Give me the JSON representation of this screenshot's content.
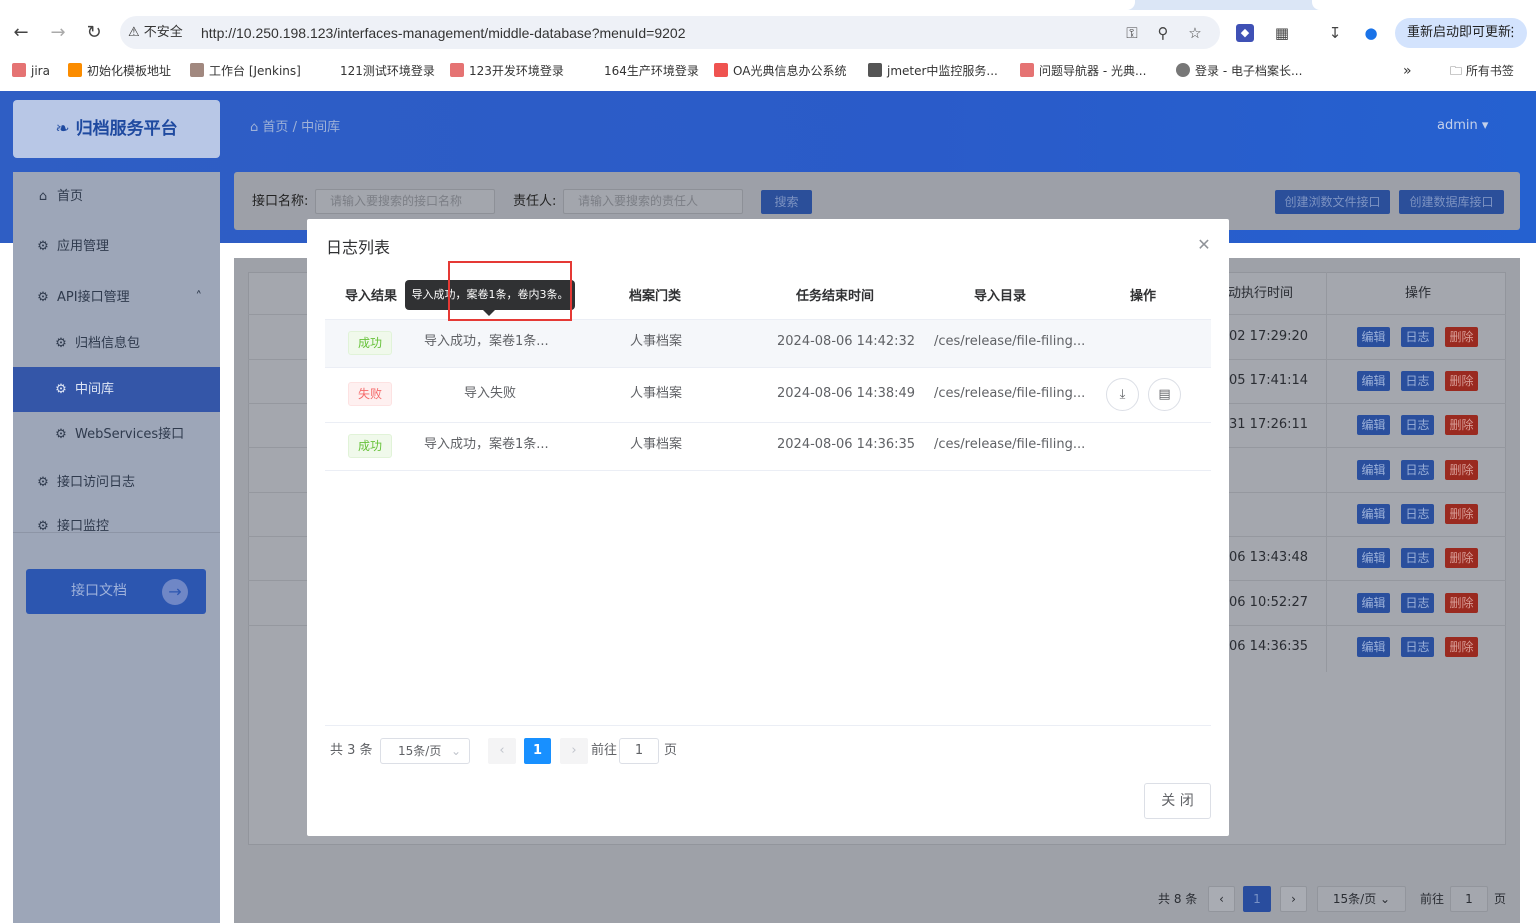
{
  "browser": {
    "insecure_label": "不安全",
    "url": "http://10.250.198.123/interfaces-management/middle-database?menuId=9202",
    "update_label": "重新启动即可更新",
    "bookmarks": [
      "jira",
      "初始化模板地址",
      "工作台 [Jenkins]",
      "121测试环境登录",
      "123开发环境登录",
      "164生产环境登录",
      "OA光典信息办公系统",
      "jmeter中监控服务...",
      "问题导航器 - 光典...",
      "登录 - 电子档案长..."
    ],
    "all_bookmarks_label": "所有书签",
    "colors": {
      "accent": "#1a73e8"
    }
  },
  "app": {
    "logo_text": "归档服务平台",
    "breadcrumb": {
      "home": "首页",
      "sep": "/",
      "current": "中间库"
    },
    "user": "admin",
    "sidebar": {
      "items": [
        {
          "label": "首页"
        },
        {
          "label": "应用管理"
        },
        {
          "label": "API接口管理"
        },
        {
          "label": "归档信息包"
        },
        {
          "label": "中间库"
        },
        {
          "label": "WebServices接口"
        },
        {
          "label": "接口访问日志"
        },
        {
          "label": "接口监控"
        }
      ],
      "doc_button": "接口文档"
    },
    "search": {
      "name_label": "接口名称:",
      "name_placeholder": "请输入要搜索的接口名称",
      "owner_label": "责任人:",
      "owner_placeholder": "请输入要搜索的责任人",
      "search_button": "搜索",
      "create_file_button": "创建浏数文件接口",
      "create_db_button": "创建数据库接口"
    },
    "table": {
      "col_exec_time": "动执行时间",
      "col_ops": "操作",
      "rows": [
        {
          "time": "02 17:29:20"
        },
        {
          "time": "05 17:41:14"
        },
        {
          "time": "31 17:26:11"
        },
        {
          "time": ""
        },
        {
          "time": ""
        },
        {
          "time": "06 13:43:48"
        },
        {
          "time": "06 10:52:27"
        },
        {
          "time": "06 14:36:35"
        }
      ],
      "edit": "编辑",
      "log": "日志",
      "delete": "删除"
    },
    "pager": {
      "total": "共 8 条",
      "page": "1",
      "size": "15条/页",
      "goto": "前往",
      "goto_val": "1",
      "page_unit": "页"
    }
  },
  "modal": {
    "title": "日志列表",
    "columns": {
      "result": "导入结果",
      "archive_type": "档案门类",
      "end_time": "任务结束时间",
      "dir": "导入目录",
      "ops": "操作"
    },
    "tooltip": "导入成功，案卷1条，卷内3条。",
    "rows": [
      {
        "status": "成功",
        "message": "导入成功，案卷1条...",
        "archive_type": "人事档案",
        "end_time": "2024-08-06 14:42:32",
        "dir": "/ces/release/file-filing..."
      },
      {
        "status": "失败",
        "message": "导入失败",
        "archive_type": "人事档案",
        "end_time": "2024-08-06 14:38:49",
        "dir": "/ces/release/file-filing..."
      },
      {
        "status": "成功",
        "message": "导入成功，案卷1条...",
        "archive_type": "人事档案",
        "end_time": "2024-08-06 14:36:35",
        "dir": "/ces/release/file-filing..."
      }
    ],
    "pager": {
      "total": "共 3 条",
      "size": "15条/页",
      "page": "1",
      "goto": "前往",
      "goto_val": "1",
      "page_unit": "页"
    },
    "close_button": "关 闭"
  }
}
